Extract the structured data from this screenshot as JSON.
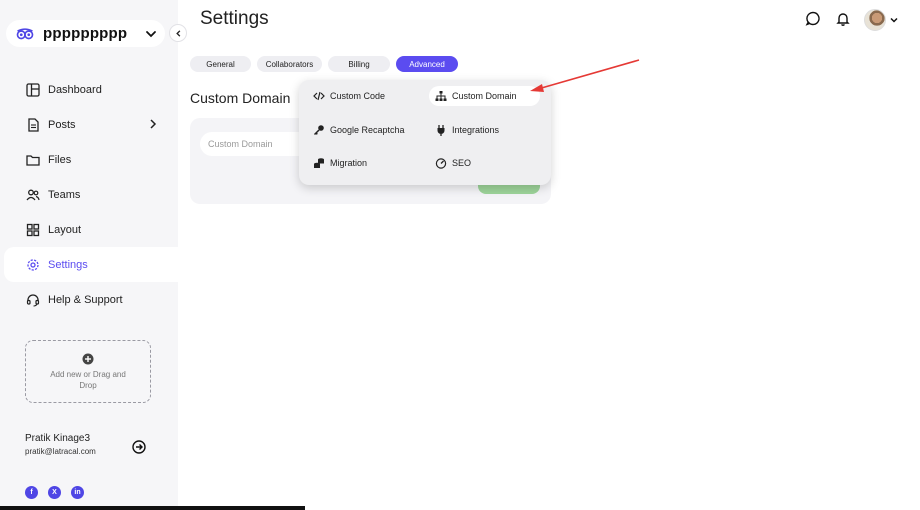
{
  "workspace": {
    "name": "ppppppppp"
  },
  "header": {
    "title": "Settings"
  },
  "sidebar": {
    "items": [
      {
        "label": "Dashboard"
      },
      {
        "label": "Posts"
      },
      {
        "label": "Files"
      },
      {
        "label": "Teams"
      },
      {
        "label": "Layout"
      },
      {
        "label": "Settings"
      },
      {
        "label": "Help & Support"
      }
    ],
    "active_index": 5,
    "dropzone_text": "Add new or Drag and Drop"
  },
  "user": {
    "name": "Pratik Kinage3",
    "email": "pratik@latracal.com"
  },
  "social": [
    "f",
    "X",
    "in"
  ],
  "tabs": [
    {
      "label": "General"
    },
    {
      "label": "Collaborators"
    },
    {
      "label": "Billing"
    },
    {
      "label": "Advanced"
    }
  ],
  "main": {
    "section_title": "Custom Domain",
    "input_placeholder": "Custom Domain"
  },
  "dropdown": {
    "items": [
      {
        "label": "Custom Code",
        "icon": "code-icon"
      },
      {
        "label": "Custom Domain",
        "icon": "sitemap-icon"
      },
      {
        "label": "Google Recaptcha",
        "icon": "key-icon"
      },
      {
        "label": "Integrations",
        "icon": "plug-icon"
      },
      {
        "label": "Migration",
        "icon": "database-icon"
      },
      {
        "label": "SEO",
        "icon": "gauge-icon"
      }
    ],
    "selected": "Custom Domain"
  },
  "colors": {
    "accent": "#5b4cf0",
    "sidebar_bg": "#f6f6f8",
    "save_button": "#9dd49a",
    "annotation_arrow": "#e53935"
  }
}
